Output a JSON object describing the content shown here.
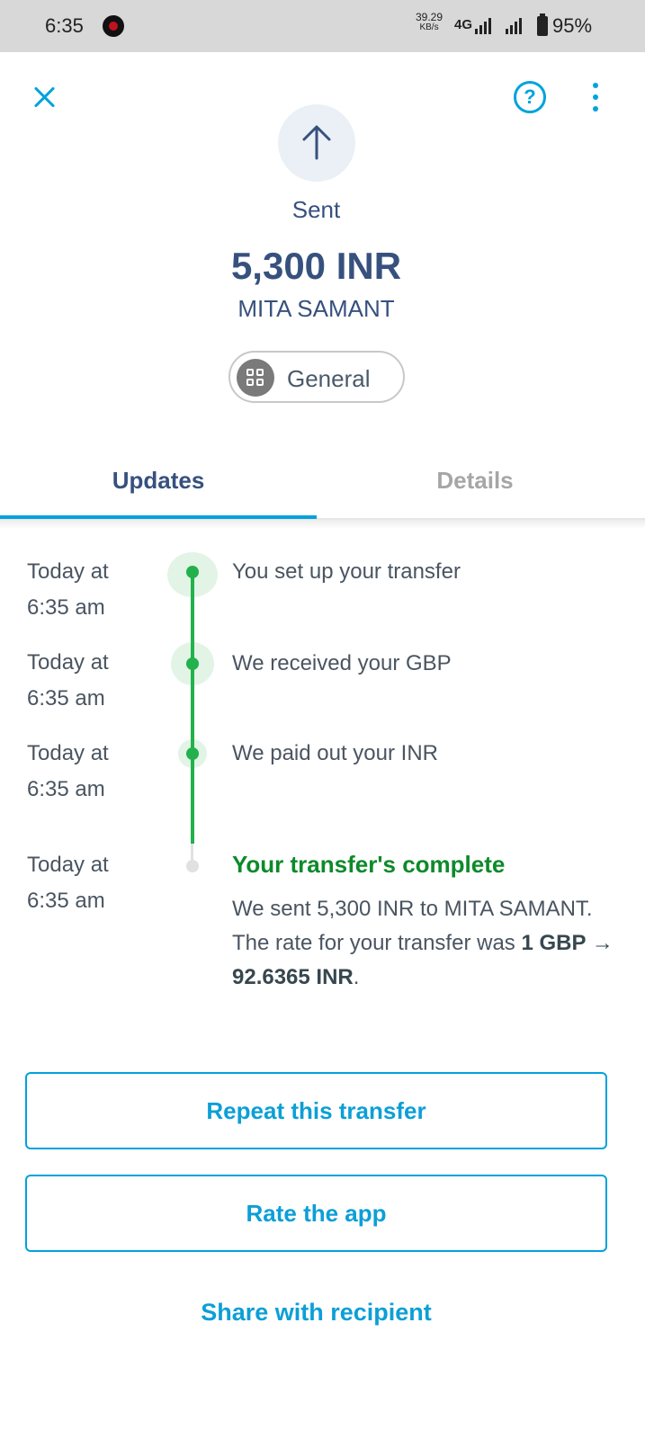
{
  "status_bar": {
    "time": "6:35",
    "net_speed_value": "39.29",
    "net_speed_unit": "KB/s",
    "network_type": "4G",
    "battery": "95%"
  },
  "header": {
    "status_label": "Sent",
    "amount": "5,300 INR",
    "recipient": "MITA SAMANT",
    "category": "General",
    "icons": [
      "close-icon",
      "help-icon",
      "more-icon",
      "arrow-up-icon",
      "category-grid-icon"
    ]
  },
  "tabs": [
    {
      "label": "Updates",
      "active": true
    },
    {
      "label": "Details",
      "active": false
    }
  ],
  "timeline": [
    {
      "time_line1": "Today at",
      "time_line2": "6:35 am",
      "text": "You set up your transfer"
    },
    {
      "time_line1": "Today at",
      "time_line2": "6:35 am",
      "text": "We received your GBP"
    },
    {
      "time_line1": "Today at",
      "time_line2": "6:35 am",
      "text": "We paid out your INR"
    }
  ],
  "completion": {
    "time_line1": "Today at",
    "time_line2": "6:35 am",
    "title": "Your transfer's complete",
    "body_prefix": "We sent 5,300 INR to MITA SAMANT. The rate for your transfer was ",
    "rate": "1 GBP → 92.6365 INR",
    "body_suffix": "."
  },
  "actions": {
    "repeat": "Repeat this transfer",
    "rate_app": "Rate the app",
    "share": "Share with recipient"
  },
  "colors": {
    "accent": "#00a2dd",
    "success": "#22b14c",
    "title_navy": "#37517e"
  }
}
